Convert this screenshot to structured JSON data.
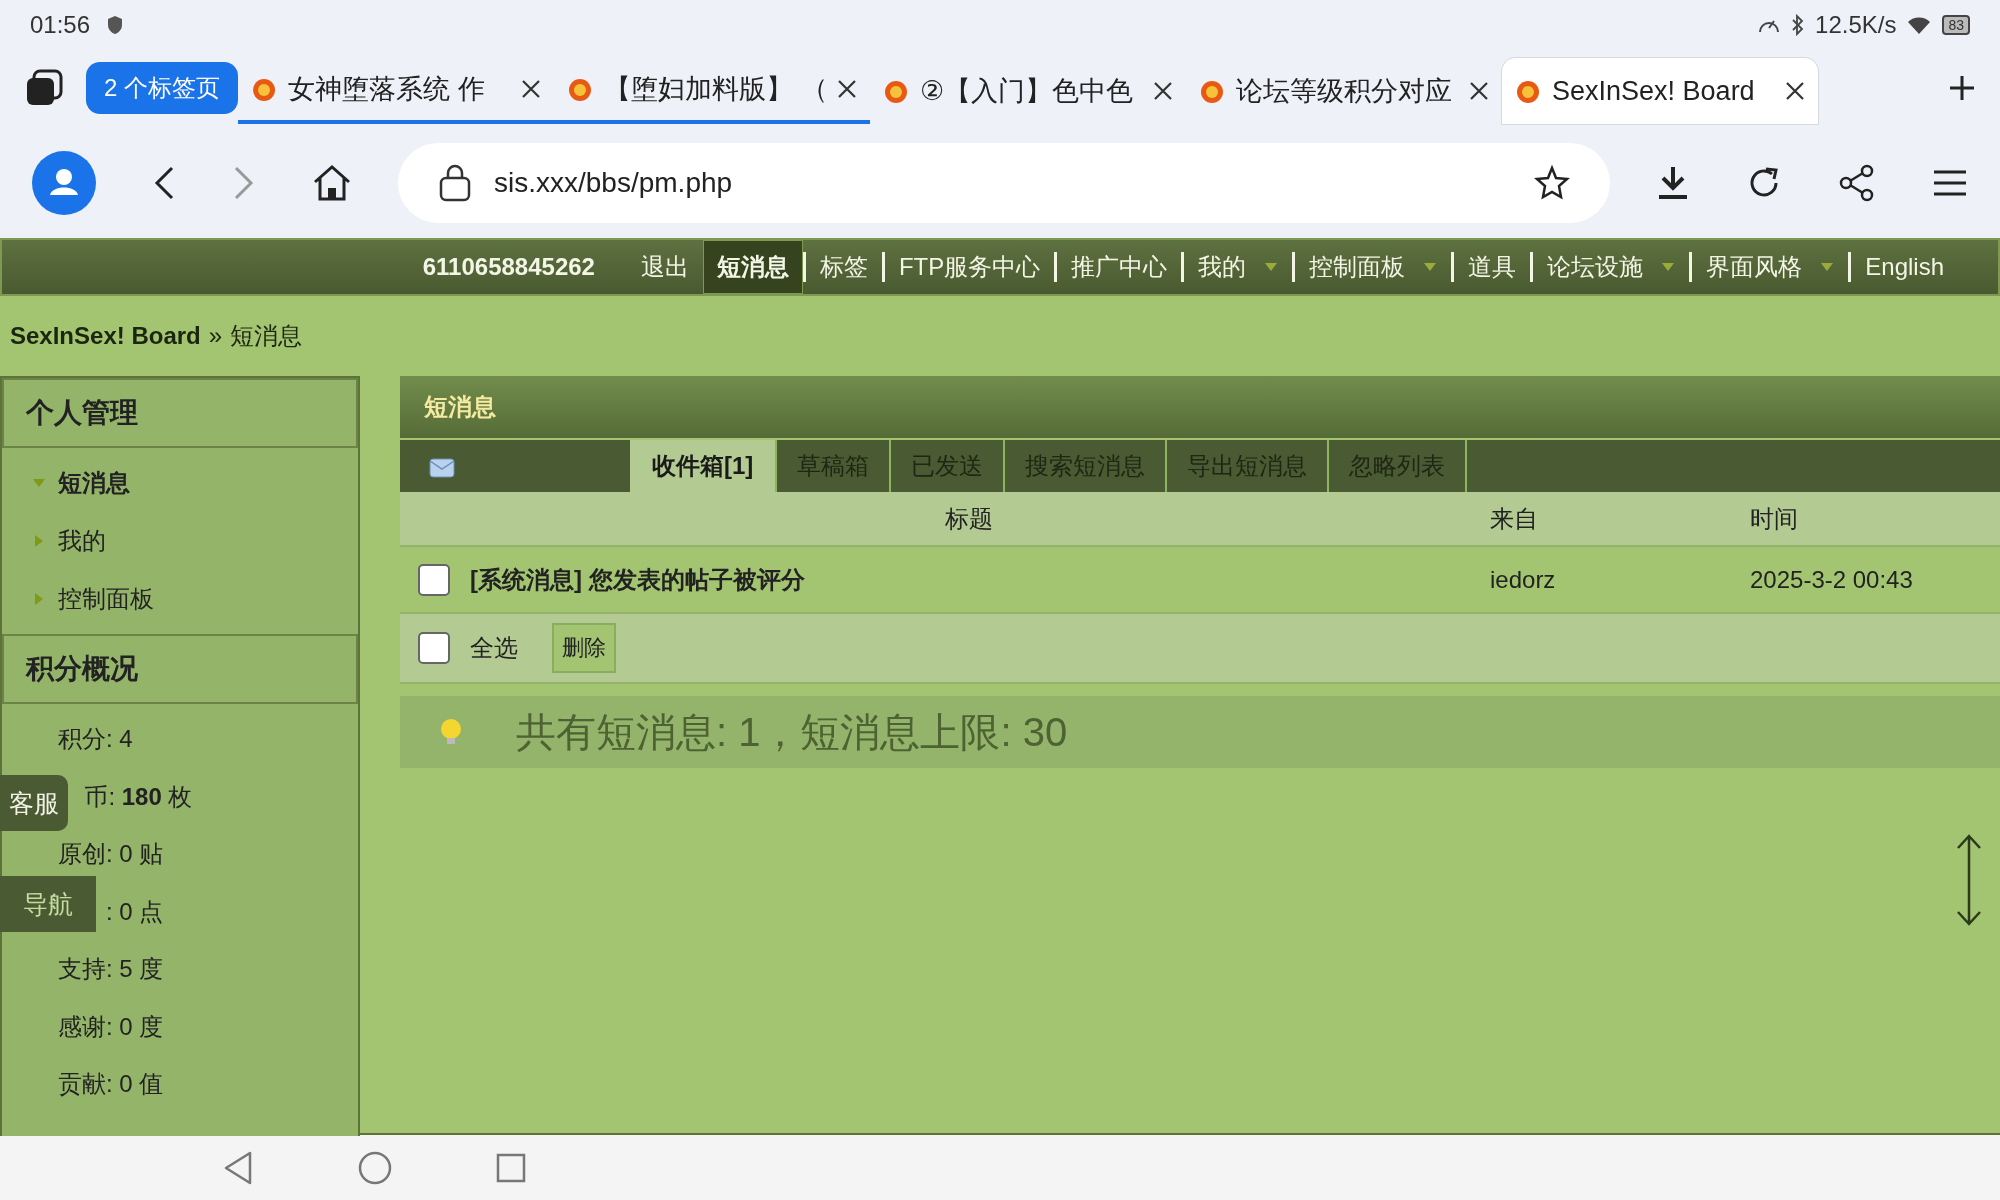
{
  "status_bar": {
    "time": "01:56",
    "net_speed": "12.5K/s",
    "battery": "83"
  },
  "browser_tabs": {
    "group_label": "2 个标签页",
    "tabs": [
      {
        "title": "女神堕落系统 作",
        "selected": false,
        "grouped": true
      },
      {
        "title": "【堕妇加料版】 （",
        "selected": false,
        "grouped": true
      },
      {
        "title": "②【入门】色中色",
        "selected": false,
        "grouped": false
      },
      {
        "title": "论坛等级积分对应",
        "selected": false,
        "grouped": false
      },
      {
        "title": "SexInSex! Board",
        "selected": true,
        "grouped": false
      }
    ]
  },
  "address_bar": {
    "url": "sis.xxx/bbs/pm.php"
  },
  "forum_nav": {
    "items": [
      {
        "label": "6110658845262",
        "kind": "user",
        "selected": false,
        "dropdown": false
      },
      {
        "label": "退出",
        "kind": "link",
        "selected": false,
        "dropdown": false
      },
      {
        "label": "短消息",
        "kind": "link",
        "selected": true,
        "dropdown": false
      },
      {
        "label": "标签",
        "kind": "link",
        "selected": false,
        "dropdown": false
      },
      {
        "label": "FTP服务中心",
        "kind": "link",
        "selected": false,
        "dropdown": false
      },
      {
        "label": "推广中心",
        "kind": "link",
        "selected": false,
        "dropdown": false
      },
      {
        "label": "我的",
        "kind": "link",
        "selected": false,
        "dropdown": true
      },
      {
        "label": "控制面板",
        "kind": "link",
        "selected": false,
        "dropdown": true
      },
      {
        "label": "道具",
        "kind": "link",
        "selected": false,
        "dropdown": false
      },
      {
        "label": "论坛设施",
        "kind": "link",
        "selected": false,
        "dropdown": true
      },
      {
        "label": "界面风格",
        "kind": "link",
        "selected": false,
        "dropdown": true
      },
      {
        "label": "English",
        "kind": "link",
        "selected": false,
        "dropdown": false
      }
    ]
  },
  "breadcrumb": {
    "home": "SexInSex! Board",
    "separator": "»",
    "current": "短消息"
  },
  "sidebar": {
    "menu_title": "个人管理",
    "menu_items": [
      {
        "label": "短消息",
        "expanded": true
      },
      {
        "label": "我的",
        "expanded": false
      },
      {
        "label": "控制面板",
        "expanded": false
      }
    ],
    "stats_title": "积分概况",
    "stats": [
      {
        "text": "积分: 4",
        "kind": "plain"
      },
      {
        "text": "币: **180** 枚",
        "kind": "under_service_button"
      },
      {
        "text": "原创: 0 贴",
        "kind": "plain"
      },
      {
        "text": ": 0 点",
        "kind": "under_nav_button"
      },
      {
        "text": "支持: 5 度",
        "kind": "plain"
      },
      {
        "text": "感谢: 0 度",
        "kind": "plain"
      },
      {
        "text": "贡献: 0 值",
        "kind": "plain"
      }
    ]
  },
  "main": {
    "title": "短消息",
    "tabs": [
      {
        "label": "收件箱[1]",
        "selected": true
      },
      {
        "label": "草稿箱",
        "selected": false
      },
      {
        "label": "已发送",
        "selected": false
      },
      {
        "label": "搜索短消息",
        "selected": false
      },
      {
        "label": "导出短消息",
        "selected": false
      },
      {
        "label": "忽略列表",
        "selected": false
      }
    ],
    "columns": [
      "标题",
      "来自",
      "时间"
    ],
    "messages": [
      {
        "checked": false,
        "subject": "[系统消息] 您发表的帖子被评分",
        "from": "iedorz",
        "time": "2025-3-2 00:43"
      }
    ],
    "select_all": {
      "label": "全选",
      "checked": false
    },
    "delete_button": "删除",
    "info": "共有短消息: 1，短消息上限: 30"
  },
  "floating_buttons": [
    "客服",
    "导航"
  ]
}
